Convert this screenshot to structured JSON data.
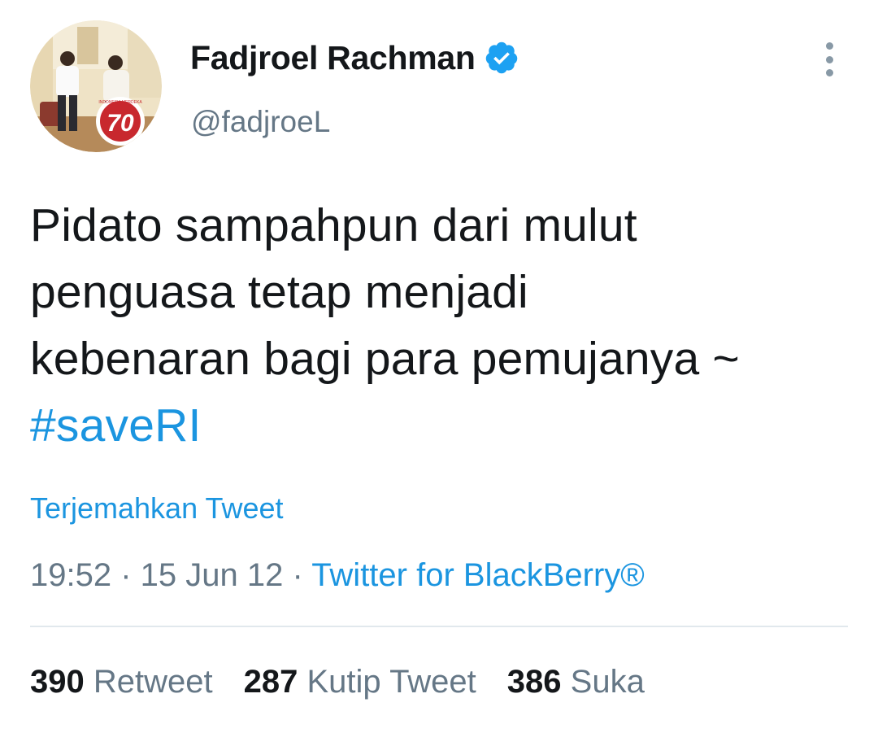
{
  "user": {
    "display_name": "Fadjroel Rachman",
    "handle": "@fadjroeL",
    "avatar_badge_text": "70",
    "avatar_badge_caption": "INDONESIA MERDEKA",
    "verified_icon": "verified-badge-icon",
    "more_icon": "more-vertical-icon"
  },
  "tweet": {
    "lines": [
      "Pidato sampahpun dari mulut",
      "penguasa tetap menjadi",
      "kebenaran bagi para pemujanya ~"
    ],
    "hashtag": "#saveRI",
    "translate_label": "Terjemahkan Tweet",
    "time": "19:52",
    "date": "15 Jun 12",
    "separator": " · ",
    "source": "Twitter for BlackBerry®"
  },
  "stats": {
    "retweets": {
      "count": "390",
      "label": "Retweet"
    },
    "quotes": {
      "count": "287",
      "label": "Kutip Tweet"
    },
    "likes": {
      "count": "386",
      "label": "Suka"
    }
  },
  "colors": {
    "link": "#1b95e0",
    "secondary_text": "#657786",
    "primary_text": "#14171a",
    "verified": "#1da1f2",
    "divider": "#e1e8ed"
  }
}
